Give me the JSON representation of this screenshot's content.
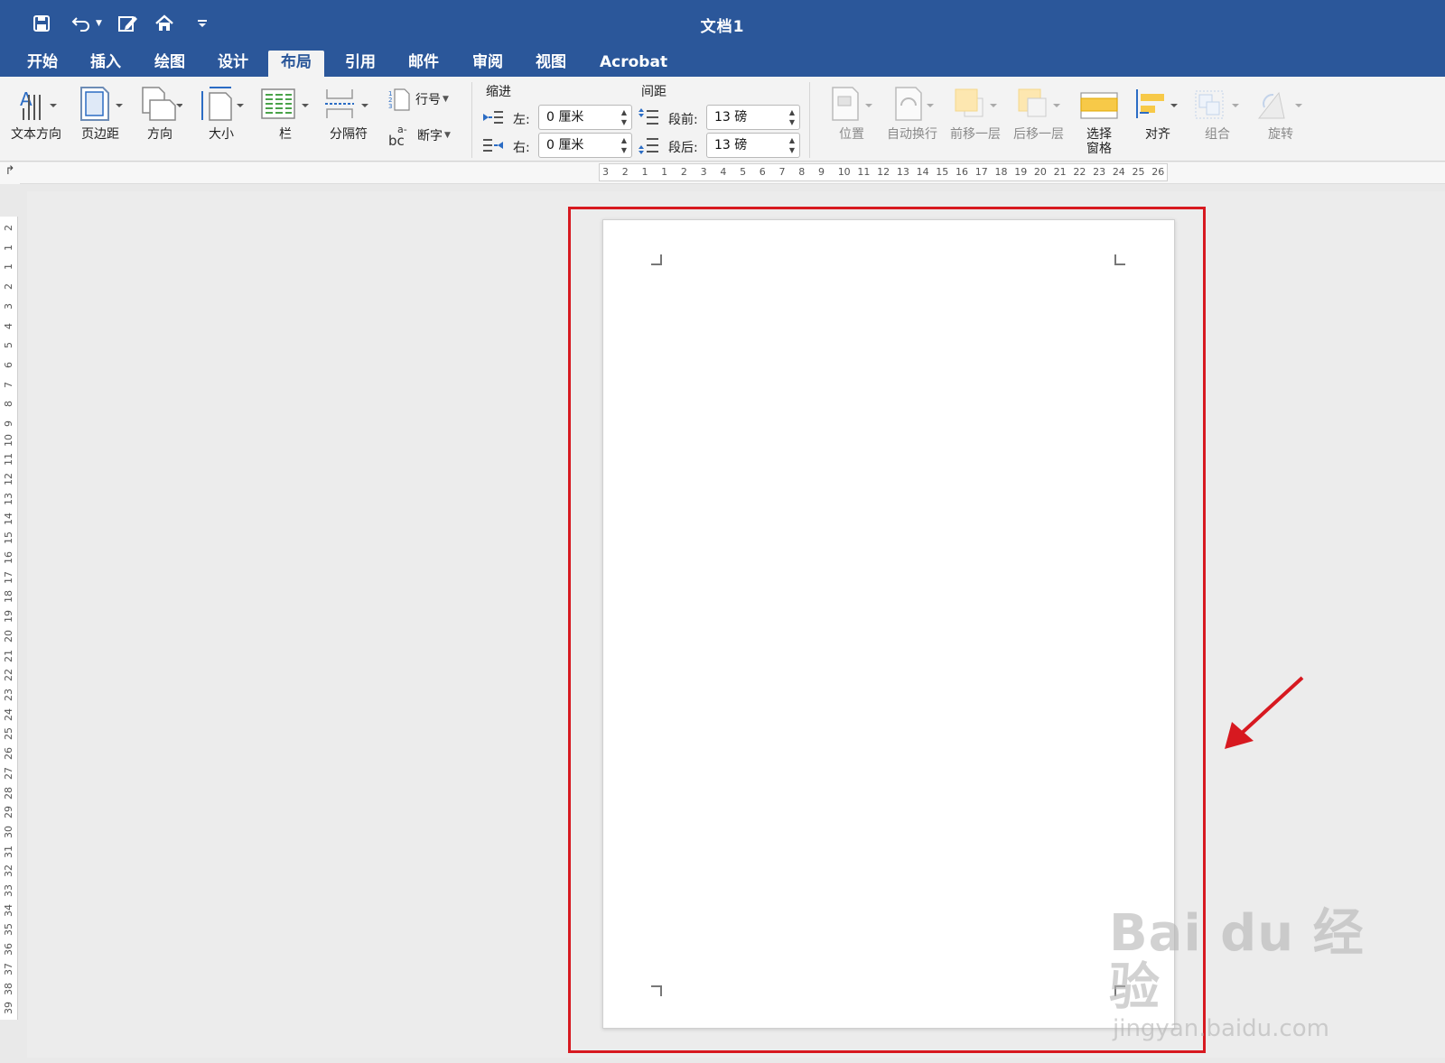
{
  "window": {
    "title": "文档1"
  },
  "quick_access": [
    "save-icon",
    "undo-icon",
    "edit-icon",
    "home-icon",
    "customize-icon"
  ],
  "tabs": [
    {
      "label": "开始",
      "active": false
    },
    {
      "label": "插入",
      "active": false
    },
    {
      "label": "绘图",
      "active": false
    },
    {
      "label": "设计",
      "active": false
    },
    {
      "label": "布局",
      "active": true
    },
    {
      "label": "引用",
      "active": false
    },
    {
      "label": "邮件",
      "active": false
    },
    {
      "label": "审阅",
      "active": false
    },
    {
      "label": "视图",
      "active": false
    },
    {
      "label": "Acrobat",
      "active": false
    }
  ],
  "ribbon": {
    "text_direction": "文本方向",
    "margins": "页边距",
    "orientation": "方向",
    "size": "大小",
    "columns": "栏",
    "breaks": "分隔符",
    "line_numbers": "行号",
    "hyphenation": "断字",
    "indent": {
      "group": "缩进",
      "left_label": "左:",
      "left_value": "0 厘米",
      "right_label": "右:",
      "right_value": "0 厘米"
    },
    "spacing": {
      "group": "间距",
      "before_label": "段前:",
      "before_value": "13 磅",
      "after_label": "段后:",
      "after_value": "13 磅"
    },
    "position": "位置",
    "wrap_text": "自动换行",
    "bring_forward": "前移一层",
    "send_backward": "后移一层",
    "selection_pane": "选择\n窗格",
    "align": "对齐",
    "group": "组合",
    "rotate": "旋转"
  },
  "ruler": {
    "horizontal": [
      "3",
      "2",
      "1",
      "1",
      "2",
      "3",
      "4",
      "5",
      "6",
      "7",
      "8",
      "9",
      "10",
      "11",
      "12",
      "13",
      "14",
      "15",
      "16",
      "17",
      "18",
      "19",
      "20",
      "21",
      "22",
      "23",
      "24",
      "25",
      "26"
    ],
    "vertical": [
      "2",
      "1",
      "1",
      "2",
      "3",
      "4",
      "5",
      "6",
      "7",
      "8",
      "9",
      "10",
      "11",
      "12",
      "13",
      "14",
      "15",
      "16",
      "17",
      "18",
      "19",
      "20",
      "21",
      "22",
      "23",
      "24",
      "25",
      "26",
      "27",
      "28",
      "29",
      "30",
      "31",
      "32",
      "33",
      "34",
      "35",
      "36",
      "37",
      "38",
      "39"
    ]
  },
  "colors": {
    "title_bar": "#2b579a",
    "highlight": "#d71920"
  },
  "watermark": {
    "main": "Bai du 经验",
    "sub": "jingyan.baidu.com"
  }
}
